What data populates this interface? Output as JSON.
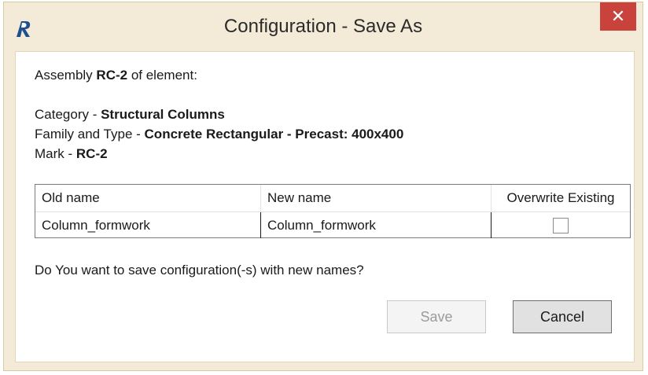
{
  "window": {
    "title": "Configuration - Save As",
    "close_glyph": "✕"
  },
  "info": {
    "assembly_prefix": "Assembly ",
    "assembly_value": "RC-2",
    "assembly_suffix": " of element:",
    "category_label": "Category - ",
    "category_value": "Structural Columns",
    "family_label": "Family and Type - ",
    "family_value": "Concrete Rectangular - Precast: 400x400",
    "mark_label": "Mark - ",
    "mark_value": "RC-2"
  },
  "table": {
    "headers": [
      "Old name",
      "New name",
      "Overwrite Existing"
    ],
    "rows": [
      {
        "old_name": "Column_formwork",
        "new_name": "Column_formwork",
        "overwrite": false
      }
    ]
  },
  "question": "Do You want to save configuration(-s) with new names?",
  "buttons": {
    "save_label": "Save",
    "save_enabled": false,
    "cancel_label": "Cancel"
  },
  "colors": {
    "frame": "#f3ebd7",
    "close_button": "#c9423b",
    "app_icon": "#1f4f8f"
  },
  "icons": {
    "app": "revit-app-icon",
    "close": "close-icon"
  }
}
